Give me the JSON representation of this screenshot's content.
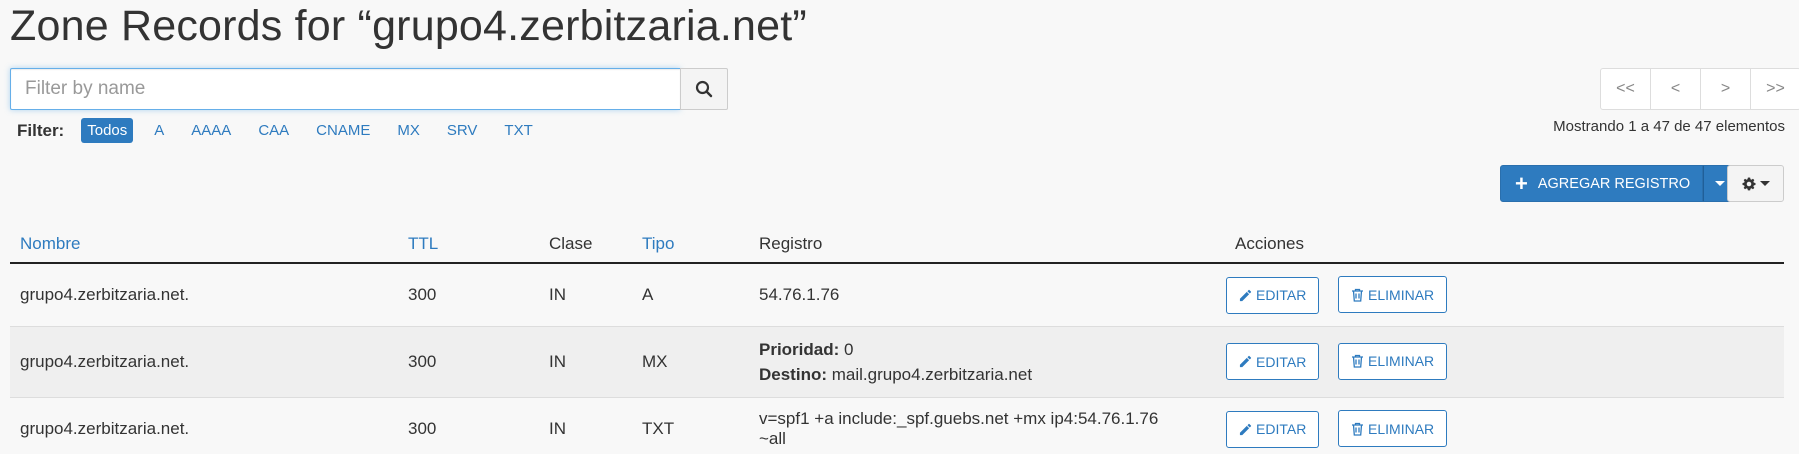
{
  "page": {
    "title": "Zone Records for “grupo4.zerbitzaria.net”"
  },
  "search": {
    "placeholder": "Filter by name",
    "icon": "search-icon"
  },
  "filter": {
    "label": "Filter:",
    "options": [
      "Todos",
      "A",
      "AAAA",
      "CAA",
      "CNAME",
      "MX",
      "SRV",
      "TXT"
    ],
    "active": "Todos"
  },
  "pager": {
    "first": "<<",
    "prev": "<",
    "next": ">",
    "last": ">>",
    "showing": "Mostrando 1 a 47 de 47 elementos"
  },
  "toolbar": {
    "add_label": "AGREGAR REGISTRO",
    "add_icon": "plus-icon",
    "settings_icon": "gear-icon",
    "accent_color": "#2e7bbf"
  },
  "table": {
    "headers": {
      "name": "Nombre",
      "ttl": "TTL",
      "class": "Clase",
      "type": "Tipo",
      "record": "Registro",
      "actions": "Acciones"
    },
    "edit_label": "EDITAR",
    "delete_label": "ELIMINAR",
    "rows": [
      {
        "name": "grupo4.zerbitzaria.net.",
        "ttl": "300",
        "class": "IN",
        "type": "A",
        "record": "54.76.1.76"
      },
      {
        "name": "grupo4.zerbitzaria.net.",
        "ttl": "300",
        "class": "IN",
        "type": "MX",
        "priority_label": "Prioridad:",
        "priority": "0",
        "dest_label": "Destino:",
        "dest": "mail.grupo4.zerbitzaria.net"
      },
      {
        "name": "grupo4.zerbitzaria.net.",
        "ttl": "300",
        "class": "IN",
        "type": "TXT",
        "record": "v=spf1 +a include:_spf.guebs.net +mx ip4:54.76.1.76 ~all"
      }
    ]
  }
}
